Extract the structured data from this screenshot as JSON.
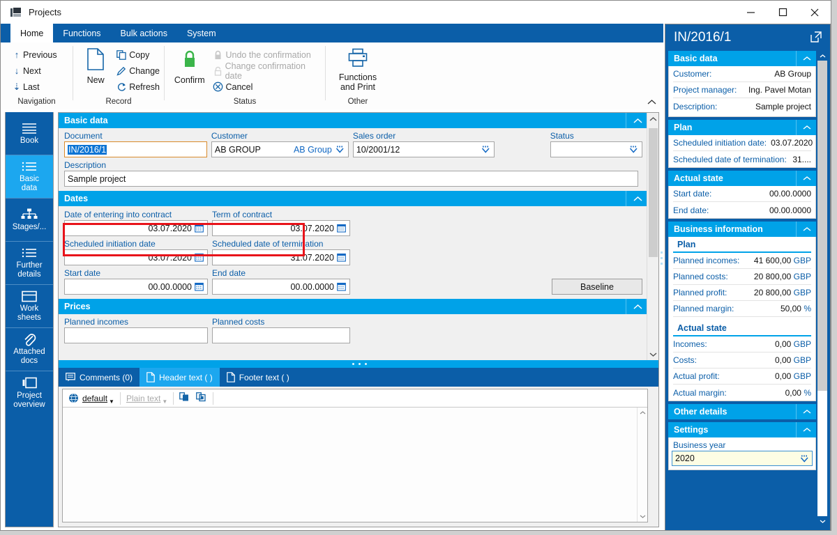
{
  "window": {
    "title": "Projects",
    "app_icon": "k2-app-icon",
    "minimize": "minimize-icon",
    "maximize": "maximize-icon",
    "close": "close-icon"
  },
  "ribbon": {
    "tabs": [
      {
        "label": "Home",
        "active": true
      },
      {
        "label": "Functions",
        "active": false
      },
      {
        "label": "Bulk actions",
        "active": false
      },
      {
        "label": "System",
        "active": false
      }
    ],
    "groups": [
      {
        "title": "Navigation",
        "items": [
          {
            "label": "Previous",
            "icon": "arrow-up-icon",
            "enabled": true
          },
          {
            "label": "Next",
            "icon": "arrow-down-icon",
            "enabled": true
          },
          {
            "label": "Last",
            "icon": "arrow-down-bar-icon",
            "enabled": true
          }
        ]
      },
      {
        "title": "Record",
        "big": {
          "label": "New",
          "icon": "new-document-icon"
        },
        "items": [
          {
            "label": "Copy",
            "icon": "copy-icon",
            "enabled": true
          },
          {
            "label": "Change",
            "icon": "pencil-icon",
            "enabled": true
          },
          {
            "label": "Refresh",
            "icon": "refresh-icon",
            "enabled": true
          }
        ]
      },
      {
        "title": "Status",
        "big": {
          "label": "Confirm",
          "icon": "lock-green-icon"
        },
        "items": [
          {
            "label": "Undo the confirmation",
            "icon": "lock-grey-icon",
            "enabled": false
          },
          {
            "label": "Change confirmation date",
            "icon": "lock-open-grey-icon",
            "enabled": false
          },
          {
            "label": "Cancel",
            "icon": "cancel-circle-icon",
            "enabled": true
          }
        ]
      },
      {
        "title": "Other",
        "big": {
          "label": "Functions\nand Print",
          "label_line1": "Functions",
          "label_line2": "and Print",
          "icon": "printer-icon"
        }
      }
    ],
    "collapse_icon": "chevron-up-icon"
  },
  "leftnav": {
    "items": [
      {
        "label": "Book",
        "icon": "book-lines-icon",
        "selected": false
      },
      {
        "label": "Basic\ndata",
        "line1": "Basic",
        "line2": "data",
        "icon": "list-icon",
        "selected": true
      },
      {
        "label": "Stages/...",
        "line1": "Stages/...",
        "line2": "",
        "icon": "hierarchy-icon",
        "selected": false
      },
      {
        "label": "Further\ndetails",
        "line1": "Further",
        "line2": "details",
        "icon": "list-icon",
        "selected": false
      },
      {
        "label": "Work\nsheets",
        "line1": "Work",
        "line2": "sheets",
        "icon": "worksheet-icon",
        "selected": false
      },
      {
        "label": "Attached\ndocs",
        "line1": "Attached",
        "line2": "docs",
        "icon": "paperclip-icon",
        "selected": false
      },
      {
        "label": "Project\noverview",
        "line1": "Project",
        "line2": "overview",
        "icon": "overview-icon",
        "selected": false
      }
    ]
  },
  "form": {
    "basic_data": {
      "header": "Basic data",
      "collapse_icon": "chevron-up-icon",
      "document": {
        "label": "Document",
        "value": "IN/2016/1",
        "selected": true
      },
      "customer": {
        "label": "Customer",
        "code": "AB GROUP",
        "name": "AB Group",
        "dropdown_icon": "dropdown-icon"
      },
      "sales_order": {
        "label": "Sales order",
        "value": "10/2001/12",
        "dropdown_icon": "dropdown-icon"
      },
      "status": {
        "label": "Status",
        "value": "",
        "dropdown_icon": "dropdown-icon"
      },
      "description": {
        "label": "Description",
        "value": "Sample project"
      }
    },
    "dates": {
      "header": "Dates",
      "collapse_icon": "chevron-up-icon",
      "fields": [
        {
          "label": "Date of entering into contract",
          "value": "03.07.2020",
          "highlighted": true
        },
        {
          "label": "Term of contract",
          "value": "03.07.2020",
          "highlighted": true
        },
        {
          "label": "Scheduled initiation date",
          "value": "03.07.2020",
          "highlighted": false
        },
        {
          "label": "Scheduled date of termination",
          "value": "31.07.2020",
          "highlighted": false
        },
        {
          "label": "Start date",
          "value": "00.00.0000",
          "highlighted": false
        },
        {
          "label": "End date",
          "value": "00.00.0000",
          "highlighted": false
        }
      ],
      "baseline_button": "Baseline",
      "calendar_icon": "calendar-icon"
    },
    "prices": {
      "header": "Prices",
      "collapse_icon": "chevron-down-icon",
      "planned_incomes_label": "Planned incomes",
      "planned_costs_label": "Planned costs"
    }
  },
  "bottom_tabs": [
    {
      "label": "Comments (0)",
      "icon": "comment-icon",
      "state": "active"
    },
    {
      "label": "Header text ( )",
      "icon": "page-icon",
      "state": "lit"
    },
    {
      "label": "Footer text ( )",
      "icon": "page-icon",
      "state": "normal"
    }
  ],
  "editor": {
    "language": "default",
    "language_icon": "globe-icon",
    "format": "Plain text",
    "copy_icon": "copy-block-icon",
    "add_icon": "copy-add-icon",
    "content": "",
    "scroll_up_icon": "chevron-up-icon",
    "scroll_down_icon": "chevron-down-icon"
  },
  "rightpanel": {
    "title": "IN/2016/1",
    "popout_icon": "popout-icon",
    "sections": [
      {
        "header": "Basic data",
        "collapse_icon": "chevron-up-icon",
        "rows": [
          {
            "key": "Customer:",
            "value": "AB Group"
          },
          {
            "key": "Project manager:",
            "value": "Ing. Pavel Motan"
          },
          {
            "key": "Description:",
            "value": "Sample project"
          }
        ]
      },
      {
        "header": "Plan",
        "collapse_icon": "chevron-up-icon",
        "rows": [
          {
            "key": "Scheduled initiation date:",
            "value": "03.07.2020"
          },
          {
            "key": "Scheduled date of termination:",
            "value": "31...."
          }
        ]
      },
      {
        "header": "Actual state",
        "collapse_icon": "chevron-up-icon",
        "rows": [
          {
            "key": "Start date:",
            "value": "00.00.0000"
          },
          {
            "key": "End date:",
            "value": "00.00.0000"
          }
        ]
      }
    ],
    "business_information": {
      "header": "Business information",
      "collapse_icon": "chevron-up-icon",
      "plan_subtitle": "Plan",
      "plan_rows": [
        {
          "key": "Planned incomes:",
          "value": "41 600,00",
          "currency": "GBP"
        },
        {
          "key": "Planned costs:",
          "value": "20 800,00",
          "currency": "GBP"
        },
        {
          "key": "Planned profit:",
          "value": "20 800,00",
          "currency": "GBP"
        },
        {
          "key": "Planned margin:",
          "value": "50,00",
          "currency": "%"
        }
      ],
      "actual_subtitle": "Actual state",
      "actual_rows": [
        {
          "key": "Incomes:",
          "value": "0,00",
          "currency": "GBP"
        },
        {
          "key": "Costs:",
          "value": "0,00",
          "currency": "GBP"
        },
        {
          "key": "Actual profit:",
          "value": "0,00",
          "currency": "GBP"
        },
        {
          "key": "Actual margin:",
          "value": "0,00",
          "currency": "%"
        }
      ]
    },
    "other_details": {
      "header": "Other details",
      "collapse_icon": "chevron-up-icon"
    },
    "settings": {
      "header": "Settings",
      "collapse_icon": "chevron-up-icon",
      "business_year_label": "Business year",
      "business_year_value": "2020",
      "dropdown_icon": "dropdown-icon"
    }
  },
  "colors": {
    "ribbon_blue": "#0b5ea8",
    "section_cyan": "#00a2e8",
    "selected_nav": "#1ca7ef",
    "highlight_red": "#e8131a",
    "link_blue": "#1168c4",
    "confirm_green": "#3bb54a"
  }
}
